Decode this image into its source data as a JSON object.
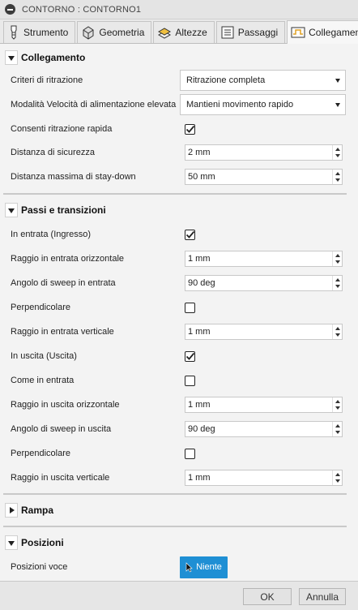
{
  "window": {
    "title": "CONTORNO : CONTORNO1"
  },
  "tabs": [
    {
      "label": "Strumento",
      "icon": "tool-icon"
    },
    {
      "label": "Geometria",
      "icon": "geometry-icon"
    },
    {
      "label": "Altezze",
      "icon": "heights-icon"
    },
    {
      "label": "Passaggi",
      "icon": "passes-icon"
    },
    {
      "label": "Collegamento",
      "icon": "linking-icon",
      "active": true
    }
  ],
  "collegamento": {
    "title": "Collegamento",
    "criteri_label": "Criteri di ritrazione",
    "criteri_value": "Ritrazione completa",
    "modalita_label": "Modalità Velocità di alimentazione elevata",
    "modalita_value": "Mantieni movimento rapido",
    "consenti_label": "Consenti ritrazione rapida",
    "consenti_checked": true,
    "distanza_label": "Distanza di sicurezza",
    "distanza_value": "2 mm",
    "staydown_label": "Distanza massima di stay-down",
    "staydown_value": "50 mm"
  },
  "passi": {
    "title": "Passi e transizioni",
    "rows": [
      {
        "label": "In entrata (Ingresso)",
        "type": "checkbox",
        "checked": true
      },
      {
        "label": "Raggio in entrata orizzontale",
        "type": "spin",
        "value": "1 mm"
      },
      {
        "label": "Angolo di sweep in entrata",
        "type": "spin",
        "value": "90 deg"
      },
      {
        "label": "Perpendicolare",
        "type": "checkbox",
        "checked": false
      },
      {
        "label": "Raggio in entrata verticale",
        "type": "spin",
        "value": "1 mm"
      },
      {
        "label": "In uscita (Uscita)",
        "type": "checkbox",
        "checked": true
      },
      {
        "label": "Come in entrata",
        "type": "checkbox",
        "checked": false
      },
      {
        "label": "Raggio in uscita orizzontale",
        "type": "spin",
        "value": "1 mm"
      },
      {
        "label": "Angolo di sweep in uscita",
        "type": "spin",
        "value": "90 deg"
      },
      {
        "label": "Perpendicolare",
        "type": "checkbox",
        "checked": false
      },
      {
        "label": "Raggio in uscita verticale",
        "type": "spin",
        "value": "1 mm"
      }
    ]
  },
  "rampa": {
    "title": "Rampa"
  },
  "posizioni": {
    "title": "Posizioni",
    "voce_label": "Posizioni voce",
    "voce_button": "Niente"
  },
  "footer": {
    "ok": "OK",
    "cancel": "Annulla"
  },
  "colors": {
    "accent": "#1f8fd4"
  }
}
